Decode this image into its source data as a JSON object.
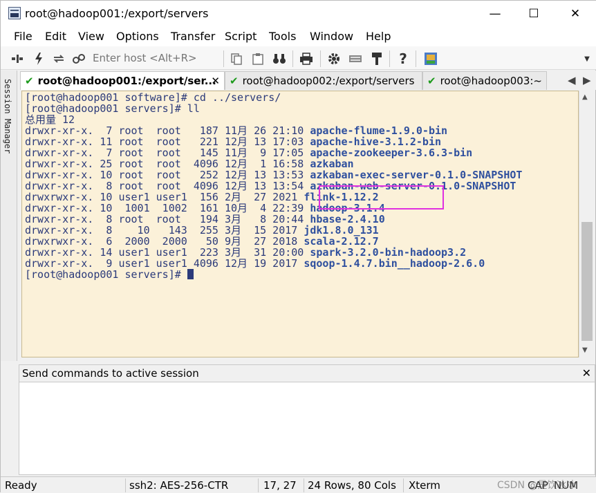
{
  "window": {
    "title": "root@hadoop001:/export/servers",
    "minimize": "—",
    "maximize": "☐",
    "close": "✕"
  },
  "menu": [
    "File",
    "Edit",
    "View",
    "Options",
    "Transfer",
    "Script",
    "Tools",
    "Window",
    "Help"
  ],
  "toolbar": {
    "host_placeholder": "Enter host <Alt+R>",
    "icons": [
      "connect-icon",
      "lightning-icon",
      "reconnect-icon",
      "link-icon",
      "copy-icon",
      "paste-icon",
      "find-icon",
      "print-icon",
      "gear-icon",
      "keymap-icon",
      "key-icon",
      "help-icon",
      "sftp-icon"
    ]
  },
  "side_panel": {
    "label": "Session Manager"
  },
  "tabs": [
    {
      "label": "root@hadoop001:/export/ser...",
      "active": true,
      "close": "✕"
    },
    {
      "label": "root@hadoop002:/export/servers",
      "active": false
    },
    {
      "label": "root@hadoop003:~",
      "active": false
    }
  ],
  "tab_nav": {
    "prev": "◀",
    "next": "▶"
  },
  "terminal": {
    "prompt_lines": [
      "[root@hadoop001 software]# cd ../servers/",
      "[root@hadoop001 servers]# ll",
      "总用量 12"
    ],
    "listing": [
      {
        "meta": "drwxr-xr-x.  7 root  root   187 11月 26 21:10",
        "name": "apache-flume-1.9.0-bin"
      },
      {
        "meta": "drwxr-xr-x. 11 root  root   221 12月 13 17:03",
        "name": "apache-hive-3.1.2-bin"
      },
      {
        "meta": "drwxr-xr-x.  7 root  root   145 11月  9 17:05",
        "name": "apache-zookeeper-3.6.3-bin"
      },
      {
        "meta": "drwxr-xr-x. 25 root  root  4096 12月  1 16:58",
        "name": "azkaban"
      },
      {
        "meta": "drwxr-xr-x. 10 root  root   252 12月 13 13:53",
        "name": "azkaban-exec-server-0.1.0-SNAPSHOT"
      },
      {
        "meta": "drwxr-xr-x.  8 root  root  4096 12月 13 13:54",
        "name": "azkaban-web-server-0.1.0-SNAPSHOT"
      },
      {
        "meta": "drwxrwxr-x. 10 user1 user1  156 2月  27 2021",
        "name": "flink-1.12.2"
      },
      {
        "meta": "drwxr-xr-x. 10  1001  1002  161 10月  4 22:39",
        "name": "hadoop-3.1.4"
      },
      {
        "meta": "drwxr-xr-x.  8 root  root   194 3月   8 20:44",
        "name": "hbase-2.4.10"
      },
      {
        "meta": "drwxr-xr-x.  8    10   143  255 3月  15 2017",
        "name": "jdk1.8.0_131"
      },
      {
        "meta": "drwxrwxr-x.  6  2000  2000   50 9月  27 2018",
        "name": "scala-2.12.7"
      },
      {
        "meta": "drwxr-xr-x. 14 user1 user1  223 3月  31 20:00",
        "name": "spark-3.2.0-bin-hadoop3.2"
      },
      {
        "meta": "drwxr-xr-x.  9 user1 user1 4096 12月 19 2017",
        "name": "sqoop-1.4.7.bin__hadoop-2.6.0"
      }
    ],
    "final_prompt": "[root@hadoop001 servers]# "
  },
  "scrollbar": {
    "up": "▲",
    "down": "▼",
    "position": 0.6
  },
  "command_panel": {
    "title": "Send commands to active session",
    "close": "✕"
  },
  "status": {
    "ready": "Ready",
    "cipher": "ssh2: AES-256-CTR",
    "cursor_pos": "17,  27",
    "size": "24 Rows, 80 Cols",
    "term": "Xterm",
    "caps": "CAP",
    "num": "NUM",
    "watermark": "CSDN @是饮冰冰"
  },
  "colors": {
    "terminal_bg": "#fbf1d9",
    "terminal_fg": "#2b3a7a",
    "highlight": "#e030e0",
    "tab_check": "#1c9a1c"
  }
}
